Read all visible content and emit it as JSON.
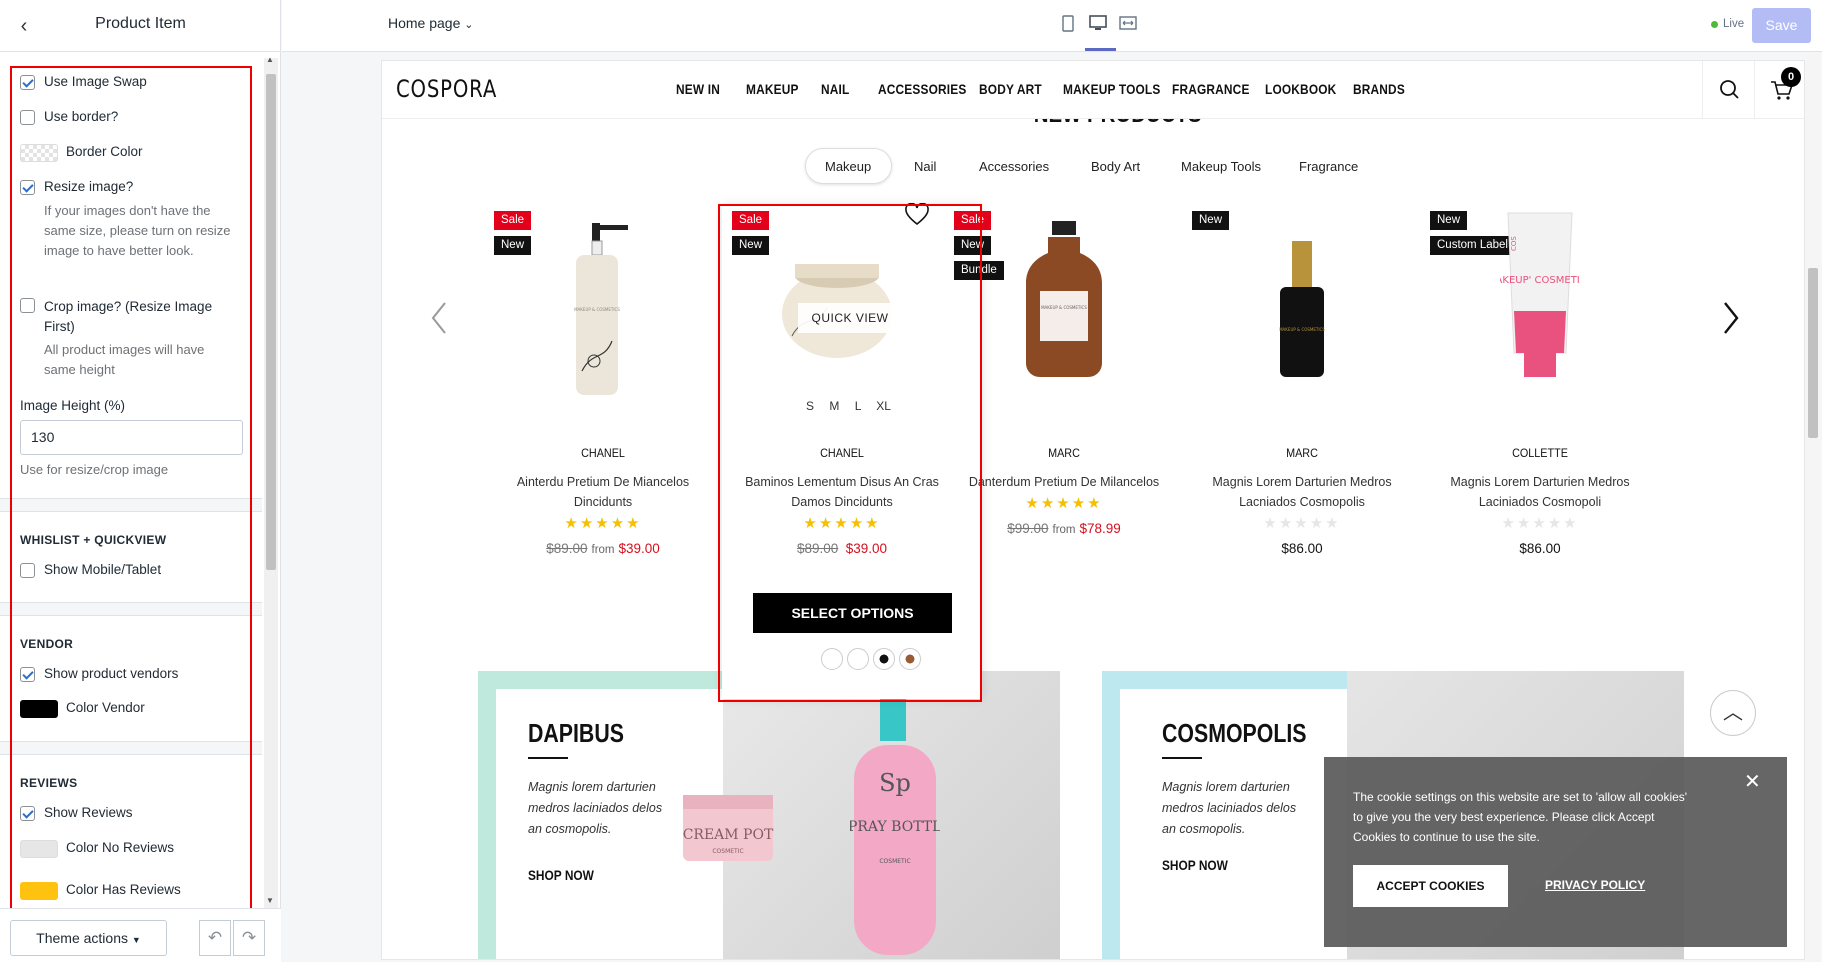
{
  "sidebar": {
    "title": "Product Item",
    "options": {
      "use_image_swap": "Use Image Swap",
      "use_border": "Use border?",
      "border_color": "Border Color",
      "resize_image": "Resize image?",
      "resize_help": "If your images don't have the same size, please turn on resize image to have better look.",
      "crop_image": "Crop image? (Resize Image First)",
      "crop_help": "All product images will have same height",
      "image_height_label": "Image Height (%)",
      "image_height_value": "130",
      "image_height_help": "Use for resize/crop image"
    },
    "sections": {
      "wishlist": "WHISLIST + QUICKVIEW",
      "show_mobile": "Show Mobile/Tablet",
      "vendor": "VENDOR",
      "show_vendors": "Show product vendors",
      "color_vendor": "Color Vendor",
      "reviews": "REVIEWS",
      "show_reviews": "Show Reviews",
      "color_no_reviews": "Color No Reviews",
      "color_has_reviews": "Color Has Reviews"
    },
    "colors": {
      "vendor": "#000000",
      "no_reviews": "#e6e6e6",
      "has_reviews": "#ffc20e"
    },
    "footer": {
      "theme_actions": "Theme actions",
      "undo_icon": "undo-icon",
      "redo_icon": "redo-icon"
    }
  },
  "topbar": {
    "page": "Home page",
    "live": "Live",
    "save": "Save"
  },
  "store": {
    "logo": "COSPORA",
    "nav": [
      "NEW IN",
      "MAKEUP",
      "NAIL",
      "ACCESSORIES",
      "BODY ART",
      "MAKEUP TOOLS",
      "FRAGRANCE",
      "LOOKBOOK",
      "BRANDS"
    ],
    "cart_count": "0",
    "section_title": "NEW PRODUCTS",
    "categories": [
      "Makeup",
      "Nail",
      "Accessories",
      "Body Art",
      "Makeup Tools",
      "Fragrance"
    ],
    "quick_view": "QUICK VIEW",
    "sizes": [
      "S",
      "M",
      "L",
      "XL"
    ],
    "select_options": "SELECT OPTIONS",
    "products": [
      {
        "badges": [
          "Sale",
          "New"
        ],
        "brand": "CHANEL",
        "name": "Ainterdu Pretium De Miancelos Dincidunts",
        "old": "$89.00",
        "from": "from",
        "price": "$39.00"
      },
      {
        "badges": [
          "Sale",
          "New"
        ],
        "brand": "CHANEL",
        "name": "Baminos Lementum Disus An Cras Damos Dincidunts",
        "old": "$89.00",
        "price": "$39.00"
      },
      {
        "badges": [
          "Sale",
          "New",
          "Bundle"
        ],
        "brand": "MARC",
        "name": "Danterdum Pretium De Milancelos",
        "old": "$99.00",
        "from": "from",
        "price": "$78.99"
      },
      {
        "badges": [
          "New"
        ],
        "brand": "MARC",
        "name": "Magnis Lorem Darturien Medros Lacniados Cosmopolis",
        "price": "$86.00"
      },
      {
        "badges": [
          "New",
          "Custom Label"
        ],
        "brand": "COLLETTE",
        "name": "Magnis Lorem Darturien Medros Laciniados Cosmopoli",
        "price": "$86.00"
      }
    ],
    "banners": [
      {
        "title": "DAPIBUS",
        "text": "Magnis lorem darturien medros laciniados delos an cosmopolis.",
        "shop": "SHOP NOW",
        "jar": "CREAM POT",
        "jar_sub": "COSMETIC",
        "bottle": "SPRAY BOTTLE",
        "bottle_sub": "COSMETIC",
        "bottle_logo": "Sp"
      },
      {
        "title": "COSMOPOLIS",
        "text": "Magnis lorem darturien medros laciniados delos an cosmopolis.",
        "shop": "SHOP NOW"
      }
    ],
    "cookie": {
      "text": "The cookie settings on this website are set to 'allow all cookies' to give you the very best experience. Please click Accept Cookies to continue to use the site.",
      "accept": "ACCEPT COOKIES",
      "privacy": "PRIVACY POLICY"
    },
    "product_image_labels": {
      "p0_label": "MAKEUP & COSMETICS",
      "p2_label": "MAKEUP & COSMETICS",
      "p3_label": "MAKEUP & COSMETICS",
      "p4_tube": "MAKEUP' COSMETICS",
      "p4_side": "COS"
    }
  }
}
